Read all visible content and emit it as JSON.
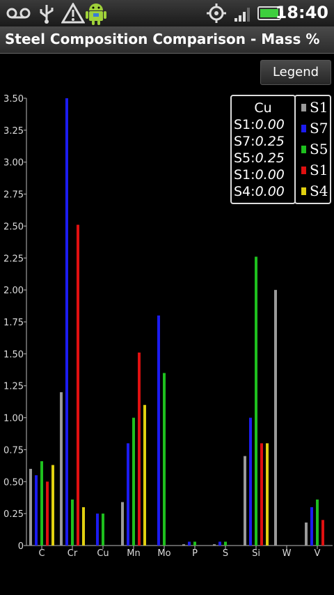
{
  "status_bar": {
    "time": "18:40",
    "icons": [
      "voicemail-icon",
      "usb-icon",
      "warning-icon",
      "android-icon",
      "gps-icon",
      "signal-icon",
      "battery-icon"
    ]
  },
  "app": {
    "title": "Steel Composition Comparison - Mass %",
    "legend_button": "Legend"
  },
  "tooltip": {
    "title": "Cu",
    "rows": [
      {
        "label": "S1:",
        "value": "0.00"
      },
      {
        "label": "S7:",
        "value": "0.25"
      },
      {
        "label": "S5:",
        "value": "0.25"
      },
      {
        "label": "S1:",
        "value": "0.00"
      },
      {
        "label": "S4:",
        "value": "0.00"
      }
    ]
  },
  "legend": [
    {
      "label": "S1",
      "color": "#9a9a9a"
    },
    {
      "label": "S7",
      "color": "#1c1cf0"
    },
    {
      "label": "S5",
      "color": "#1ec01e"
    },
    {
      "label": "S1",
      "color": "#e01010"
    },
    {
      "label": "S4",
      "color": "#e0d010"
    }
  ],
  "chart_data": {
    "type": "bar",
    "title": "",
    "xlabel": "",
    "ylabel": "",
    "ylim": [
      0,
      3.5
    ],
    "yticks": [
      "0",
      "0.25",
      "0.50",
      "0.75",
      "1.00",
      "1.25",
      "1.50",
      "1.75",
      "2.00",
      "2.25",
      "2.50",
      "2.75",
      "3.00",
      "3.25",
      "3.50"
    ],
    "categories": [
      "C",
      "Cr",
      "Cu",
      "Mn",
      "Mo",
      "P",
      "S",
      "Si",
      "W",
      "V"
    ],
    "series": [
      {
        "name": "S1",
        "color": "#9a9a9a",
        "values": [
          0.6,
          1.2,
          0.0,
          0.34,
          0.0,
          0.01,
          0.01,
          0.7,
          2.0,
          0.18
        ]
      },
      {
        "name": "S7",
        "color": "#1c1cf0",
        "values": [
          0.55,
          3.5,
          0.25,
          0.8,
          1.8,
          0.03,
          0.03,
          1.0,
          0.0,
          0.3
        ]
      },
      {
        "name": "S5",
        "color": "#1ec01e",
        "values": [
          0.66,
          0.36,
          0.25,
          1.0,
          1.35,
          0.03,
          0.03,
          2.26,
          0.0,
          0.36
        ]
      },
      {
        "name": "S1",
        "color": "#e01010",
        "values": [
          0.5,
          2.51,
          0.0,
          1.51,
          0.0,
          0.0,
          0.0,
          0.8,
          0.0,
          0.2
        ]
      },
      {
        "name": "S4",
        "color": "#e0d010",
        "values": [
          0.63,
          0.3,
          0.0,
          1.1,
          0.0,
          0.0,
          0.0,
          0.8,
          0.0,
          0.0
        ]
      }
    ],
    "grid": false,
    "legend_position": "top-right"
  }
}
